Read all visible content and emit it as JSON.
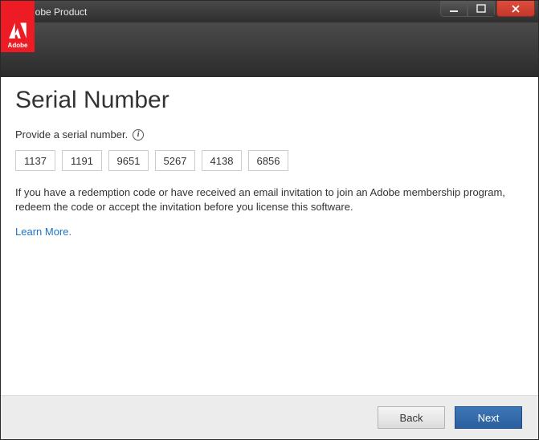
{
  "window": {
    "title": "Adobe Product"
  },
  "brand": {
    "label": "Adobe"
  },
  "page": {
    "heading": "Serial Number",
    "instruction": "Provide a serial number.",
    "serial": [
      "1137",
      "1191",
      "9651",
      "5267",
      "4138",
      "6856"
    ],
    "note": "If you have a redemption code or have received an email invitation to join an Adobe membership program, redeem the code or accept the invitation before you license this software.",
    "learn_more": "Learn More."
  },
  "footer": {
    "back": "Back",
    "next": "Next"
  }
}
